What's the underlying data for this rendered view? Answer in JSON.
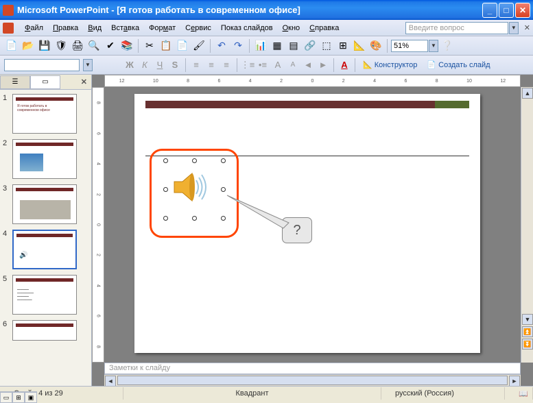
{
  "titlebar": {
    "app": "Microsoft PowerPoint",
    "doc": "[Я готов работать в современном офисе]"
  },
  "menu": {
    "file": "Файл",
    "edit": "Правка",
    "view": "Вид",
    "insert": "Вставка",
    "format": "Формат",
    "tools": "Сервис",
    "slideshow": "Показ слайдов",
    "window": "Окно",
    "help": "Справка",
    "askbox": "Введите вопрос"
  },
  "toolbar": {
    "zoom": "51%",
    "designer": "Конструктор",
    "newslide": "Создать слайд"
  },
  "ruler": {
    "h": [
      "12",
      "10",
      "8",
      "6",
      "4",
      "2",
      "0",
      "2",
      "4",
      "6",
      "8",
      "10",
      "12"
    ],
    "v": [
      "8",
      "6",
      "4",
      "2",
      "0",
      "2",
      "4",
      "6",
      "8"
    ]
  },
  "thumbs": [
    1,
    2,
    3,
    4,
    5,
    6
  ],
  "selected_thumb": 4,
  "callout_text": "?",
  "notes_placeholder": "Заметки к слайду",
  "status": {
    "left": "Слайд 4 из 29",
    "center": "Квадрант",
    "lang": "русский (Россия)"
  }
}
